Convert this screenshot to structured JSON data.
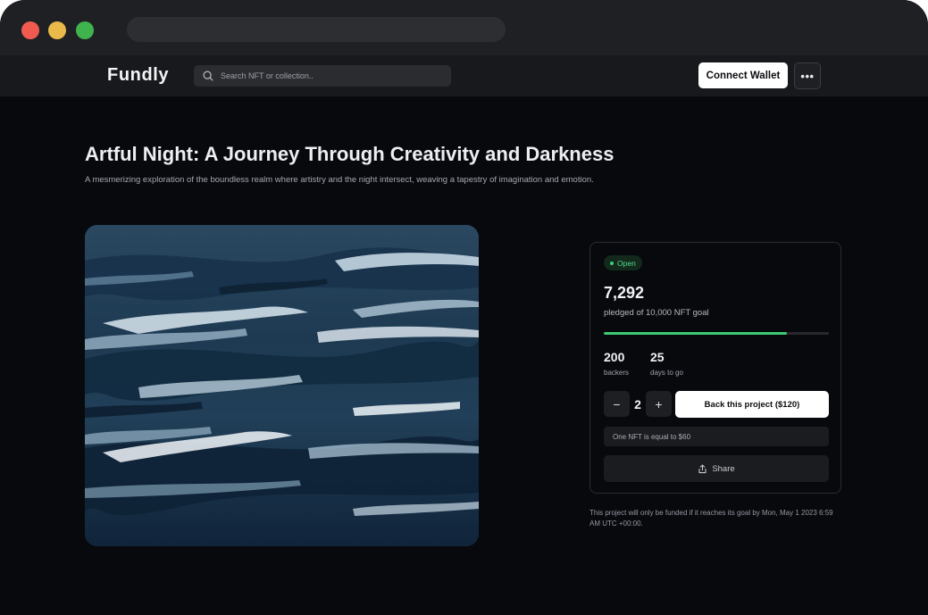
{
  "app": {
    "name": "Fundly"
  },
  "search": {
    "placeholder": "Search NFT or collection.."
  },
  "nav": {
    "connect_label": "Connect Wallet",
    "more_label": "•••"
  },
  "project": {
    "title": "Artful Night: A Journey Through Creativity and Darkness",
    "subtitle": "A mesmerizing exploration of the boundless realm where artistry and the night intersect, weaving a tapestry of imagination and emotion."
  },
  "funding": {
    "status": "Open",
    "pledged": "7,292",
    "pledged_label": "pledged of 10,000 NFT goal",
    "progress_fraction": 0.8144,
    "backers_value": "200",
    "backers_label": "backers",
    "days_value": "25",
    "days_label": "days to go",
    "quantity": "2",
    "minus_label": "−",
    "plus_label": "+",
    "back_button_label": "Back this project ($120)",
    "nft_info": "One NFT is equal to $60",
    "share_label": "Share",
    "footnote": "This project will only be funded if it reaches its goal by Mon, May 1 2023 6:59 AM UTC +00:00."
  },
  "colors": {
    "accent_green": "#3ecb72",
    "background": "#07090d",
    "artwork_blue": "#1b2f42"
  },
  "icons": {
    "search": "search-icon",
    "more": "more-dots-icon",
    "share": "share-icon"
  }
}
